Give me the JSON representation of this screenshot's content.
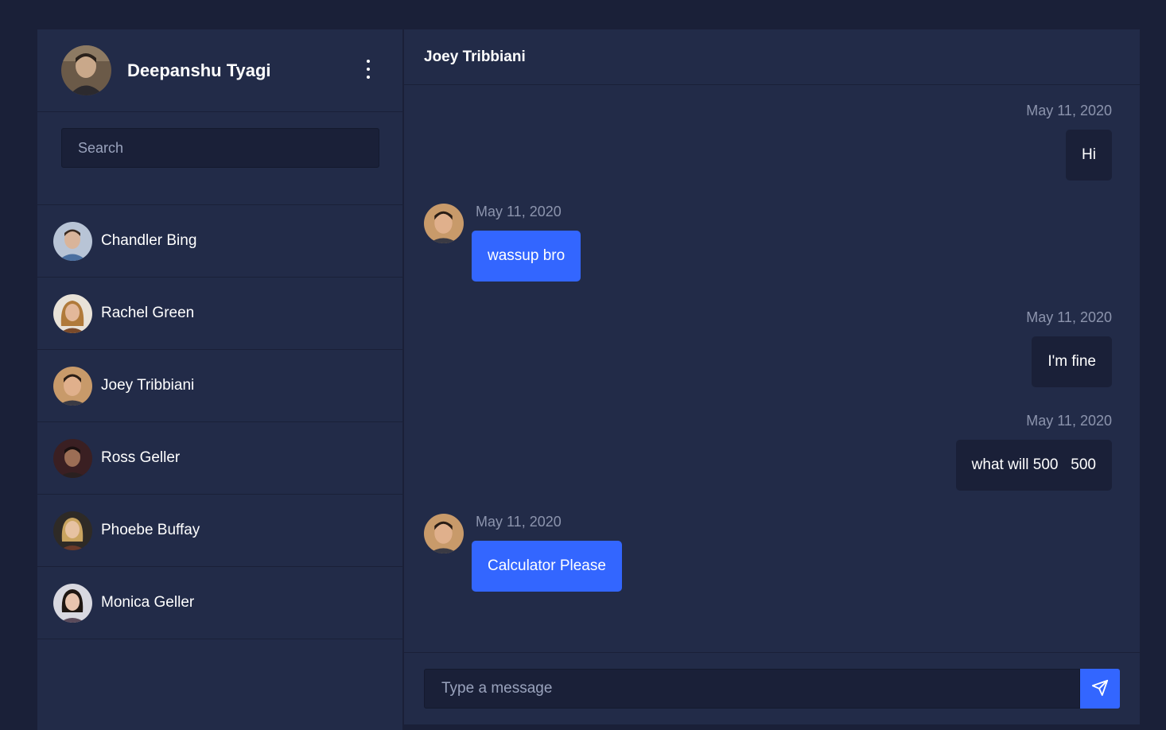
{
  "user": {
    "name": "Deepanshu Tyagi",
    "avatar_icon": "user-avatar"
  },
  "menu": {
    "icon": "more-vertical-icon"
  },
  "search": {
    "placeholder": "Search"
  },
  "contacts": [
    {
      "name": "Chandler Bing"
    },
    {
      "name": "Rachel Green"
    },
    {
      "name": "Joey Tribbiani"
    },
    {
      "name": "Ross Geller"
    },
    {
      "name": "Phoebe Buffay"
    },
    {
      "name": "Monica Geller"
    }
  ],
  "chat": {
    "title": "Joey Tribbiani",
    "messages": [
      {
        "from": "me",
        "date": "May 11, 2020",
        "text": "Hi"
      },
      {
        "from": "them",
        "date": "May 11, 2020",
        "text": "wassup bro"
      },
      {
        "from": "me",
        "date": "May 11, 2020",
        "text": "I'm fine"
      },
      {
        "from": "me",
        "date": "May 11, 2020",
        "text": "what will 500   500"
      },
      {
        "from": "them",
        "date": "May 11, 2020",
        "text": "Calculator Please"
      }
    ]
  },
  "composer": {
    "placeholder": "Type a message",
    "send_icon": "send-icon"
  },
  "colors": {
    "accent": "#3366ff",
    "background": "#1a2038",
    "panel": "#222b48"
  }
}
